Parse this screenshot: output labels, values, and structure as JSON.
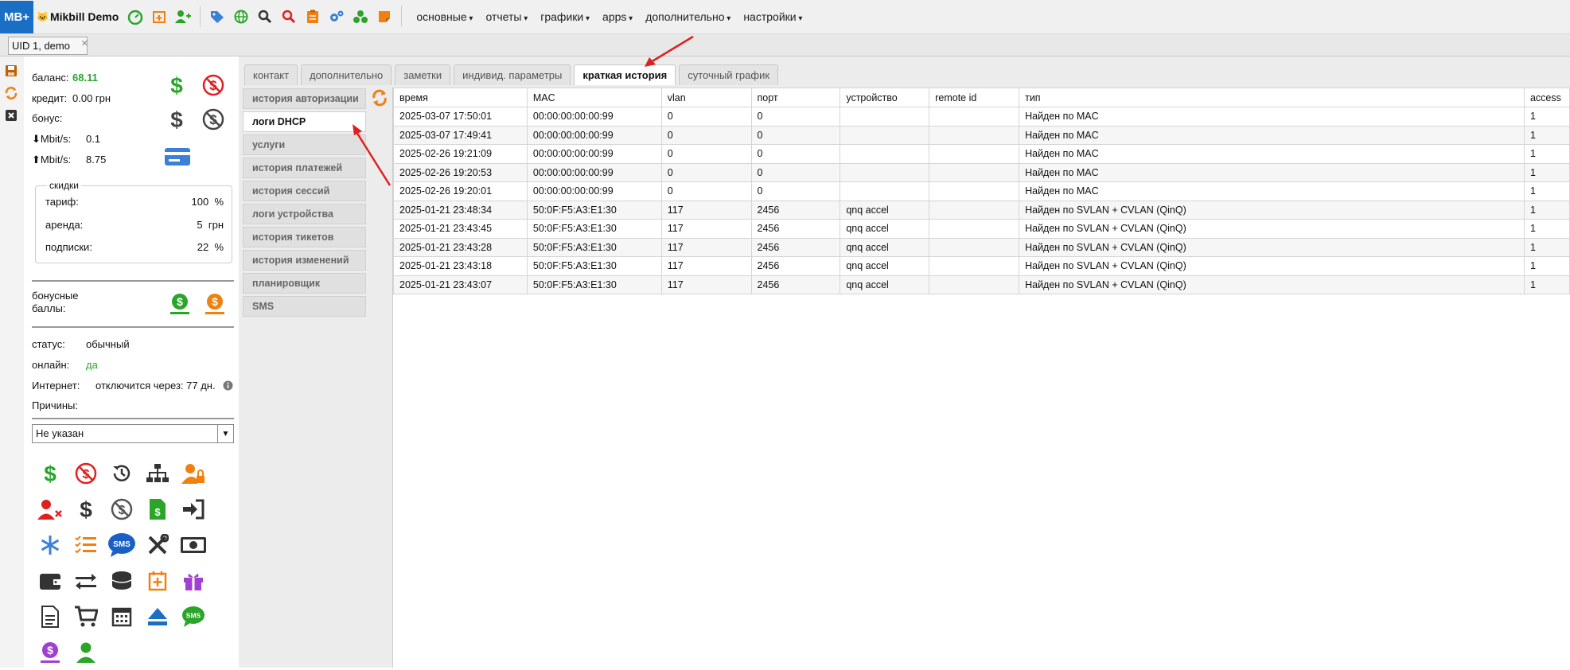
{
  "app": {
    "logo": "MB+",
    "brand_name": "Mikbill Demo"
  },
  "toolbar": {
    "icons": [
      "speedometer-icon",
      "calendar-plus-icon",
      "user-plus-icon",
      "tags-icon",
      "globe-icon",
      "search-icon",
      "search-red-icon",
      "clipboard-icon",
      "gears-icon",
      "network-icon",
      "sticky-note-icon"
    ],
    "menu": [
      "основные",
      "отчеты",
      "графики",
      "apps",
      "дополнительно",
      "настройки"
    ]
  },
  "tabs": {
    "user_tab": "UID 1, demo",
    "close": "✕"
  },
  "sidebar": {
    "balance_label": "баланс:",
    "balance_value": "68.11",
    "credit_label": "кредит:",
    "credit_value": "0.00 грн",
    "bonus_label": "бонус:",
    "down_label": "Mbit/s:",
    "down_value": "0.1",
    "up_label": "Mbit/s:",
    "up_value": "8.75",
    "discounts": {
      "legend": "скидки",
      "rows": [
        {
          "label": "тариф:",
          "value": "100",
          "unit": "%"
        },
        {
          "label": "аренда:",
          "value": "5",
          "unit": "грн"
        },
        {
          "label": "подписки:",
          "value": "22",
          "unit": "%"
        }
      ]
    },
    "bonus_points_label": "бонусные баллы:",
    "status_label": "статус:",
    "status_value": "обычный",
    "online_label": "онлайн:",
    "online_value": "да",
    "internet_label": "Интернет:",
    "internet_value": "отключится через: 77 дн.",
    "reasons_label": "Причины:",
    "select_value": "Не указан",
    "colors": {
      "green": "#2aa52a",
      "red": "#e02020",
      "orange": "#f08010",
      "blue": "#1a6fc4",
      "purple": "#9b30c0"
    }
  },
  "htabs": [
    "контакт",
    "дополнительно",
    "заметки",
    "индивид. параметры",
    "краткая история",
    "суточный график"
  ],
  "active_htab": "краткая история",
  "vtabs": [
    "история авторизации",
    "логи DHCP",
    "услуги",
    "история платежей",
    "история сессий",
    "логи устройства",
    "история тикетов",
    "история изменений",
    "планировщик",
    "SMS"
  ],
  "active_vtab": "логи DHCP",
  "table": {
    "columns": [
      "время",
      "MAC",
      "vlan",
      "порт",
      "устройство",
      "remote id",
      "тип",
      "access"
    ],
    "rows": [
      [
        "2025-03-07 17:50:01",
        "00:00:00:00:00:99",
        "0",
        "0",
        "",
        "",
        "Найден по MAC",
        "1"
      ],
      [
        "2025-03-07 17:49:41",
        "00:00:00:00:00:99",
        "0",
        "0",
        "",
        "",
        "Найден по MAC",
        "1"
      ],
      [
        "2025-02-26 19:21:09",
        "00:00:00:00:00:99",
        "0",
        "0",
        "",
        "",
        "Найден по MAC",
        "1"
      ],
      [
        "2025-02-26 19:20:53",
        "00:00:00:00:00:99",
        "0",
        "0",
        "",
        "",
        "Найден по MAC",
        "1"
      ],
      [
        "2025-02-26 19:20:01",
        "00:00:00:00:00:99",
        "0",
        "0",
        "",
        "",
        "Найден по MAC",
        "1"
      ],
      [
        "2025-01-21 23:48:34",
        "50:0F:F5:A3:E1:30",
        "117",
        "2456",
        "qnq accel",
        "",
        "Найден по SVLAN + CVLAN (QinQ)",
        "1"
      ],
      [
        "2025-01-21 23:43:45",
        "50:0F:F5:A3:E1:30",
        "117",
        "2456",
        "qnq accel",
        "",
        "Найден по SVLAN + CVLAN (QinQ)",
        "1"
      ],
      [
        "2025-01-21 23:43:28",
        "50:0F:F5:A3:E1:30",
        "117",
        "2456",
        "qnq accel",
        "",
        "Найден по SVLAN + CVLAN (QinQ)",
        "1"
      ],
      [
        "2025-01-21 23:43:18",
        "50:0F:F5:A3:E1:30",
        "117",
        "2456",
        "qnq accel",
        "",
        "Найден по SVLAN + CVLAN (QinQ)",
        "1"
      ],
      [
        "2025-01-21 23:43:07",
        "50:0F:F5:A3:E1:30",
        "117",
        "2456",
        "qnq accel",
        "",
        "Найден по SVLAN + CVLAN (QinQ)",
        "1"
      ]
    ]
  }
}
